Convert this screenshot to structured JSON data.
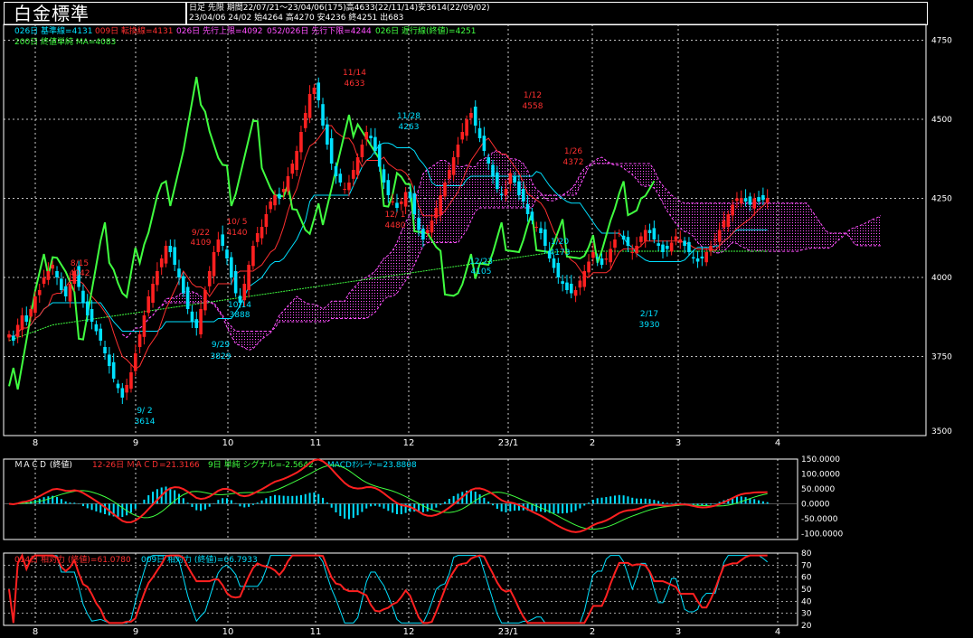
{
  "app_title": "白金標準",
  "info": {
    "line1": "日足  先限  期間22/07/21～23/04/06(175)高4633(22/11/14)安3614(22/09/02)",
    "line2": "23/04/06 24/02 始4264 高4270 安4236 終4251 出683"
  },
  "legends": {
    "main": [
      {
        "text": "026日 基準線=4131",
        "color": "#00e0ff"
      },
      {
        "text": "009日 転換線=4131",
        "color": "#ff3030"
      },
      {
        "text": "026日 先行上限=4092",
        "color": "#ff50ff"
      },
      {
        "text": "052/026日 先行下限=4244",
        "color": "#ff50ff"
      },
      {
        "text": "026日 遅行線(終値)=4251",
        "color": "#40ff40"
      },
      {
        "text": "200日 終値単純 MA=4083",
        "color": "#40ff40"
      }
    ],
    "macd": [
      {
        "text": "ＭＡＣＤ (終値)",
        "color": "#ffffff"
      },
      {
        "text": "12-26日 ＭＡＣＤ=21.3166",
        "color": "#ff3030"
      },
      {
        "text": "9日 単純 シグナル=-2.5642",
        "color": "#40ff40"
      },
      {
        "text": "MACDｵｼﾚｰﾀｰ=23.8808",
        "color": "#00e0ff"
      }
    ],
    "rsi": [
      {
        "text": "014日 相対力 (終値)=61.0780",
        "color": "#ff3030"
      },
      {
        "text": "009日 相対力 (終値)=66.7933",
        "color": "#00e0ff"
      }
    ]
  },
  "x_ticks": [
    "8",
    "9",
    "10",
    "11",
    "12",
    "23/1",
    "2",
    "3",
    "4"
  ],
  "colors": {
    "up": "#ff2020",
    "down": "#00e0ff",
    "kijun": "#00e0ff",
    "tenkan": "#ff3030",
    "chikou": "#40ff40",
    "ma": "#40ff40",
    "cloud": "#ff50ff"
  },
  "chart_data": [
    {
      "type": "candlestick",
      "ylim": [
        3500,
        4800
      ],
      "yticks": [
        3750,
        4000,
        4250,
        4500,
        4750
      ],
      "annotations": [
        {
          "date": "8/15",
          "value": "4042",
          "color": "#ff3030"
        },
        {
          "date": "9/ 2",
          "value": "3614",
          "color": "#00e0ff"
        },
        {
          "date": "9/22",
          "value": "4109",
          "color": "#ff3030"
        },
        {
          "date": "9/29",
          "value": "3829",
          "color": "#00e0ff"
        },
        {
          "date": "10/ 5",
          "value": "4140",
          "color": "#ff3030"
        },
        {
          "date": "10/14",
          "value": "3888",
          "color": "#00e0ff"
        },
        {
          "date": "11/14",
          "value": "4633",
          "color": "#ff3030"
        },
        {
          "date": "11/28",
          "value": "4263",
          "color": "#00e0ff"
        },
        {
          "date": "12/ 1",
          "value": "4480",
          "color": "#ff3030"
        },
        {
          "date": "12/23",
          "value": "4105",
          "color": "#00e0ff"
        },
        {
          "date": "1/12",
          "value": "4558",
          "color": "#ff3030"
        },
        {
          "date": "1/20",
          "value": "4173",
          "color": "#00e0ff"
        },
        {
          "date": "1/26",
          "value": "4372",
          "color": "#ff3030"
        },
        {
          "date": "2/17",
          "value": "3930",
          "color": "#00e0ff"
        }
      ],
      "close": [
        3820,
        3800,
        3850,
        3880,
        3860,
        3900,
        3940,
        3960,
        4000,
        4020,
        4040,
        4000,
        3960,
        3940,
        3980,
        4020,
        3970,
        3920,
        3880,
        3860,
        3830,
        3800,
        3760,
        3720,
        3680,
        3650,
        3620,
        3660,
        3700,
        3760,
        3820,
        3880,
        3940,
        3980,
        4020,
        4060,
        4100,
        4080,
        4040,
        4000,
        3950,
        3900,
        3860,
        3840,
        3900,
        3960,
        4020,
        4080,
        4120,
        4100,
        4060,
        4000,
        3950,
        3920,
        3980,
        4040,
        4100,
        4140,
        4160,
        4200,
        4240,
        4260,
        4250,
        4280,
        4320,
        4360,
        4400,
        4460,
        4520,
        4580,
        4600,
        4560,
        4480,
        4420,
        4360,
        4320,
        4300,
        4280,
        4300,
        4340,
        4380,
        4420,
        4460,
        4440,
        4400,
        4350,
        4300,
        4260,
        4240,
        4220,
        4240,
        4270,
        4250,
        4200,
        4150,
        4120,
        4150,
        4180,
        4220,
        4260,
        4300,
        4340,
        4380,
        4420,
        4460,
        4500,
        4520,
        4480,
        4440,
        4400,
        4360,
        4320,
        4280,
        4260,
        4280,
        4330,
        4300,
        4260,
        4240,
        4200,
        4180,
        4160,
        4140,
        4100,
        4060,
        4030,
        4000,
        3980,
        3960,
        3950,
        3960,
        3990,
        4020,
        4050,
        4080,
        4060,
        4040,
        4060,
        4090,
        4120,
        4140,
        4120,
        4100,
        4080,
        4100,
        4130,
        4150,
        4140,
        4120,
        4100,
        4080,
        4090,
        4110,
        4130,
        4120,
        4100,
        4080,
        4060,
        4050,
        4060,
        4080,
        4100,
        4120,
        4150,
        4180,
        4200,
        4230,
        4250,
        4251,
        4240,
        4230,
        4250,
        4240,
        4245,
        4251
      ],
      "ma200": [
        3800,
        3805,
        3810,
        3815,
        3820,
        3825,
        3830,
        3835,
        3840,
        3845,
        3850,
        3852,
        3854,
        3856,
        3858,
        3860,
        3862,
        3864,
        3866,
        3868,
        3870,
        3872,
        3874,
        3876,
        3878,
        3880,
        3882,
        3884,
        3886,
        3888,
        3890,
        3892,
        3894,
        3896,
        3898,
        3900,
        3902,
        3904,
        3906,
        3908,
        3910,
        3912,
        3914,
        3916,
        3918,
        3920,
        3922,
        3924,
        3926,
        3928,
        3930,
        3932,
        3934,
        3936,
        3938,
        3940,
        3942,
        3944,
        3946,
        3948,
        3950,
        3952,
        3954,
        3956,
        3958,
        3960,
        3962,
        3964,
        3966,
        3968,
        3970,
        3972,
        3974,
        3976,
        3978,
        3980,
        3982,
        3984,
        3986,
        3988,
        3990,
        3992,
        3994,
        3996,
        3998,
        4000,
        4002,
        4004,
        4006,
        4008,
        4010,
        4012,
        4014,
        4016,
        4018,
        4020,
        4022,
        4024,
        4026,
        4028,
        4030,
        4032,
        4034,
        4036,
        4038,
        4040,
        4042,
        4044,
        4046,
        4048,
        4050,
        4052,
        4054,
        4056,
        4058,
        4060,
        4062,
        4064,
        4066,
        4068,
        4070,
        4072,
        4074,
        4076,
        4078,
        4080,
        4081,
        4081,
        4081,
        4082,
        4082,
        4082,
        4082,
        4083,
        4083,
        4083,
        4083,
        4083,
        4083,
        4083,
        4083,
        4083,
        4083,
        4083,
        4083,
        4083,
        4083,
        4083,
        4083,
        4083,
        4083,
        4083,
        4083,
        4083,
        4083,
        4083,
        4083,
        4083,
        4083,
        4083,
        4083,
        4083,
        4083,
        4083,
        4083,
        4083,
        4083,
        4083,
        4083,
        4083,
        4083,
        4083,
        4083,
        4083,
        4083
      ]
    },
    {
      "type": "macd",
      "ylim": [
        -120,
        150
      ],
      "yticks": [
        150,
        100,
        50,
        0,
        -50,
        -100
      ],
      "ytick_labels": [
        "150.0000",
        "100.0000",
        "50.0000",
        "0.0000",
        "-50.0000",
        "-100.0000"
      ]
    },
    {
      "type": "rsi",
      "ylim": [
        20,
        80
      ],
      "yticks": [
        80,
        70,
        60,
        50,
        40,
        30,
        20
      ],
      "ytick_labels": [
        "80",
        "70",
        "60",
        "50",
        "40",
        "30",
        "20"
      ]
    }
  ]
}
